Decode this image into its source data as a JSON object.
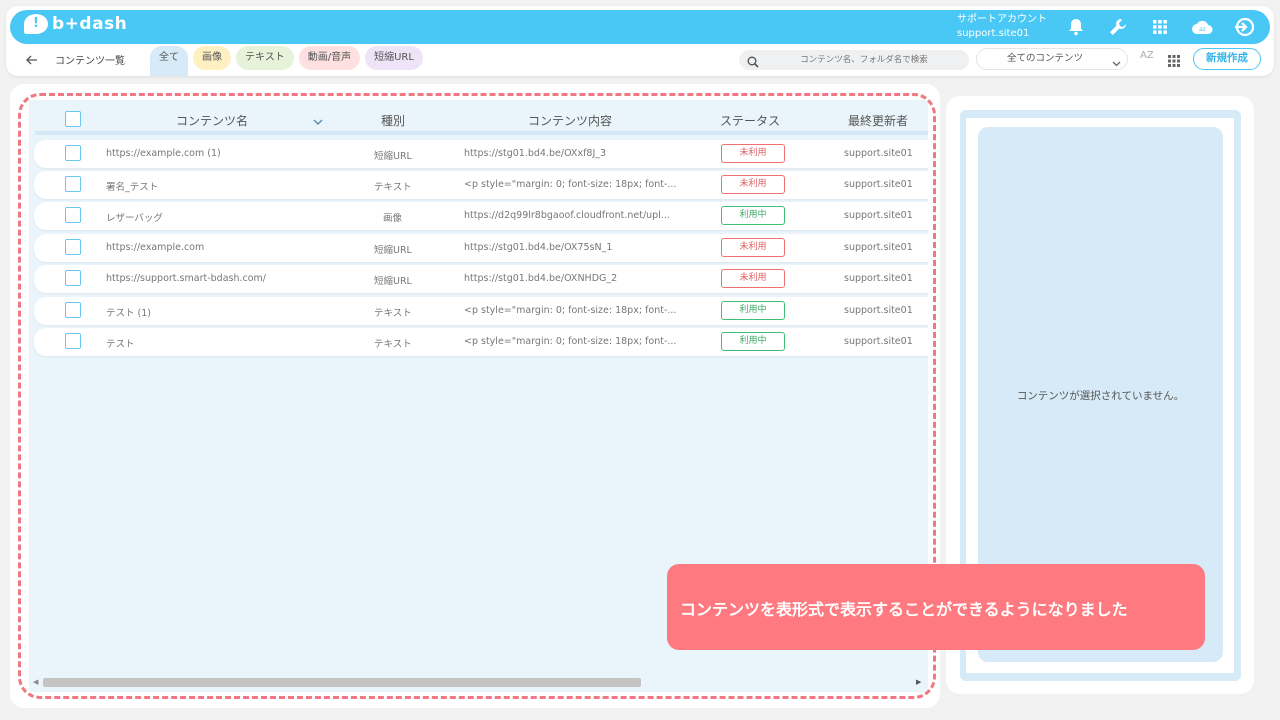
{
  "header": {
    "logo_text": "b+dash",
    "account_name": "サポートアカウント",
    "account_id": "support.site01",
    "icons": [
      "bell-icon",
      "wrench-icon",
      "apps-grid-icon",
      "cloud-tag-icon",
      "logout-icon"
    ]
  },
  "toolbar": {
    "page_title": "コンテンツ一覧",
    "tabs": [
      {
        "label": "全て",
        "color": "#d6eaf7",
        "active": true
      },
      {
        "label": "画像",
        "color": "#fff0c2"
      },
      {
        "label": "テキスト",
        "color": "#e6f2d9"
      },
      {
        "label": "動画/音声",
        "color": "#fde0df"
      },
      {
        "label": "短縮URL",
        "color": "#efe3f7"
      }
    ],
    "search_placeholder": "コンテンツ名、フォルダ名で検索",
    "filter_value": "全てのコンテンツ",
    "sort_label": "AZ",
    "new_button": "新規作成"
  },
  "table": {
    "columns": [
      "コンテンツ名",
      "種別",
      "コンテンツ内容",
      "ステータス",
      "最終更新者"
    ],
    "rows": [
      {
        "name": "https://example.com (1)",
        "type": "短縮URL",
        "content": "https://stg01.bd4.be/OXxf8J_3",
        "status": "未利用",
        "status_kind": "unused",
        "updater": "support.site01"
      },
      {
        "name": "署名_テスト",
        "type": "テキスト",
        "content": "<p style=\"margin: 0; font-size: 18px; font-...",
        "status": "未利用",
        "status_kind": "unused",
        "updater": "support.site01"
      },
      {
        "name": "レザーバッグ",
        "type": "画像",
        "content": "https://d2q99lr8bgaoof.cloudfront.net/upl...",
        "status": "利用中",
        "status_kind": "used",
        "updater": "support.site01"
      },
      {
        "name": "https://example.com",
        "type": "短縮URL",
        "content": "https://stg01.bd4.be/OX75sN_1",
        "status": "未利用",
        "status_kind": "unused",
        "updater": "support.site01"
      },
      {
        "name": "https://support.smart-bdash.com/",
        "type": "短縮URL",
        "content": "https://stg01.bd4.be/OXNHDG_2",
        "status": "未利用",
        "status_kind": "unused",
        "updater": "support.site01"
      },
      {
        "name": "テスト (1)",
        "type": "テキスト",
        "content": "<p style=\"margin: 0; font-size: 18px; font-...",
        "status": "利用中",
        "status_kind": "used",
        "updater": "support.site01"
      },
      {
        "name": "テスト",
        "type": "テキスト",
        "content": "<p style=\"margin: 0; font-size: 18px; font-...",
        "status": "利用中",
        "status_kind": "used",
        "updater": "support.site01"
      }
    ]
  },
  "detail": {
    "empty_message": "コンテンツが選択されていません。"
  },
  "callout": {
    "text": "コンテンツを表形式で表示することができるようになりました"
  },
  "colors": {
    "brand": "#4ac8f5",
    "unused": "#f07070",
    "used": "#3fbf74",
    "callout": "#ff7a80"
  }
}
